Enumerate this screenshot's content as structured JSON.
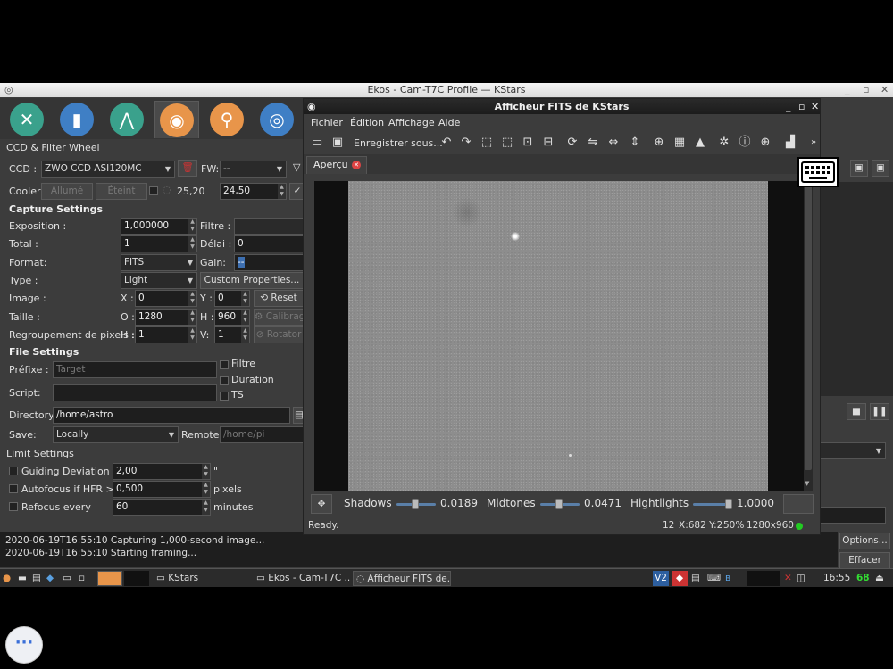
{
  "main_window": {
    "title": "Ekos - Cam-T7C Profile — KStars",
    "module_tab_icons": [
      "setup-icon",
      "scheduler-icon",
      "mount-icon",
      "capture-camera-icon",
      "focus-icon",
      "align-icon"
    ]
  },
  "capture": {
    "header": "CCD & Filter Wheel",
    "ccd_label": "CCD :",
    "ccd_value": "ZWO CCD ASI120MC",
    "fw_label": "FW:",
    "fw_value": "--",
    "cooler_label": "Cooler:",
    "cooler_on": "Allumé",
    "cooler_off": "Éteint",
    "current_temp": "25,20",
    "target_temp": "24,50",
    "capture_settings_title": "Capture Settings",
    "exposure_label": "Exposition :",
    "exposure_value": "1,000000",
    "filter_label": "Filtre :",
    "total_label": "Total :",
    "total_value": "1",
    "delay_label": "Délai :",
    "delay_value": "0",
    "format_label": "Format:",
    "format_value": "FITS",
    "gain_label": "Gain:",
    "gain_value": "--",
    "type_label": "Type :",
    "type_value": "Light",
    "custom_properties": "Custom Properties...",
    "image_label": "Image :",
    "x_label": "X :",
    "x_value": "0",
    "y_label": "Y :",
    "y_value": "0",
    "reset": "Reset",
    "size_label": "Taille :",
    "o_label": "O :",
    "o_value": "1280",
    "h_label": "H :",
    "h_value": "960",
    "calibrate": "Calibrag",
    "binning_label": "Regroupement de pixels :",
    "bin_h_label": "H :",
    "bin_h_value": "1",
    "bin_v_label": "V:",
    "bin_v_value": "1",
    "rotator": "Rotator",
    "file_settings_title": "File Settings",
    "prefix_label": "Préfixe :",
    "prefix_placeholder": "Target",
    "filter_check": "Filtre",
    "duration_check": "Duration",
    "ts_check": "TS",
    "script_label": "Script:",
    "directory_label": "Directory:",
    "directory_value": "/home/astro",
    "save_label": "Save:",
    "save_value": "Locally",
    "remote_label": "Remote:",
    "remote_placeholder": "/home/pi",
    "limit_settings_title": "Limit Settings",
    "guiding_label": "Guiding Deviation <",
    "guiding_value": "2,00",
    "guiding_unit": "\"",
    "autofocus_label": "Autofocus if HFR >",
    "autofocus_value": "0,500",
    "autofocus_unit": "pixels",
    "refocus_label": "Refocus every",
    "refocus_value": "60",
    "refocus_unit": "minutes"
  },
  "log": {
    "lines": [
      "2020-06-19T16:55:10 Capturing 1,000-second  image...",
      "2020-06-19T16:55:10 Starting framing..."
    ],
    "options_button": "Options...",
    "clear_button": "Effacer"
  },
  "fits_viewer": {
    "title": "Afficheur FITS de KStars",
    "menus": [
      "Fichier",
      "Édition",
      "Affichage",
      "Aide"
    ],
    "save_as": "Enregistrer sous...",
    "tab": "Aperçu",
    "shadows_label": "Shadows",
    "shadows_value": "0.0189",
    "midtones_label": "Midtones",
    "midtones_value": "0.0471",
    "highlights_label": "Hightlights",
    "highlights_value": "1.0000",
    "status": "Ready.",
    "pixel_value": "12",
    "coords": "X:682 Y:2",
    "zoom": "50%",
    "dimensions": "1280x960"
  },
  "taskbar": {
    "items": [
      "KStars",
      "Ekos - Cam-T7C ...",
      "Afficheur FITS de..."
    ],
    "time": "16:55",
    "battery": "68",
    "vnc": "V2"
  },
  "colors": {
    "status_led": "#22cc22",
    "stop_led": "#cc3333",
    "battery_text": "#33dd33"
  }
}
